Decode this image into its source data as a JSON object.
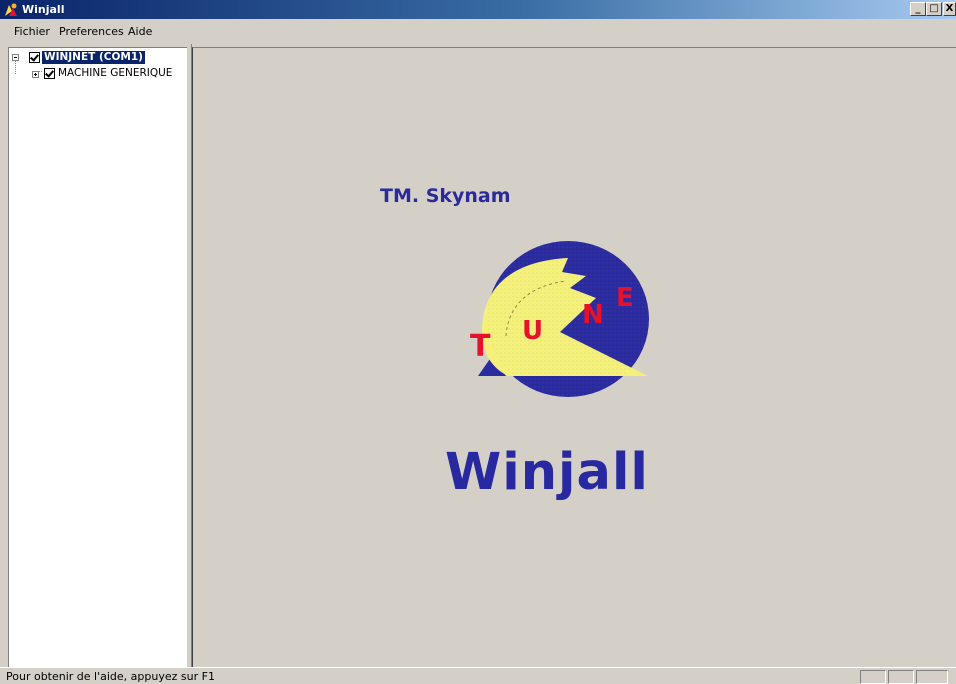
{
  "window": {
    "title": "Winjall",
    "buttons": {
      "minimize": "_",
      "maximize": "□",
      "close": "X"
    }
  },
  "menu": {
    "items": [
      {
        "label": "Fichier"
      },
      {
        "label": "Preferences"
      },
      {
        "label": "Aide"
      }
    ]
  },
  "tree": {
    "items": [
      {
        "label": "WINJNET (COM1)",
        "checked": true,
        "expanded": true,
        "selected": true
      },
      {
        "label": "MACHINE GENERIQUE",
        "checked": true,
        "expanded": false,
        "selected": false
      }
    ]
  },
  "main": {
    "company": "TM. Skynam",
    "logo_letters": [
      "T",
      "U",
      "N",
      "E"
    ],
    "brand": "Winjall"
  },
  "colors": {
    "titlebar_start": "#0a246a",
    "logo_blue": "#2b2ba0",
    "logo_yellow": "#f4f07a",
    "logo_red": "#e8102a",
    "brand_text": "#2828a0"
  },
  "status": {
    "text": "Pour obtenir de l'aide, appuyez sur F1"
  }
}
